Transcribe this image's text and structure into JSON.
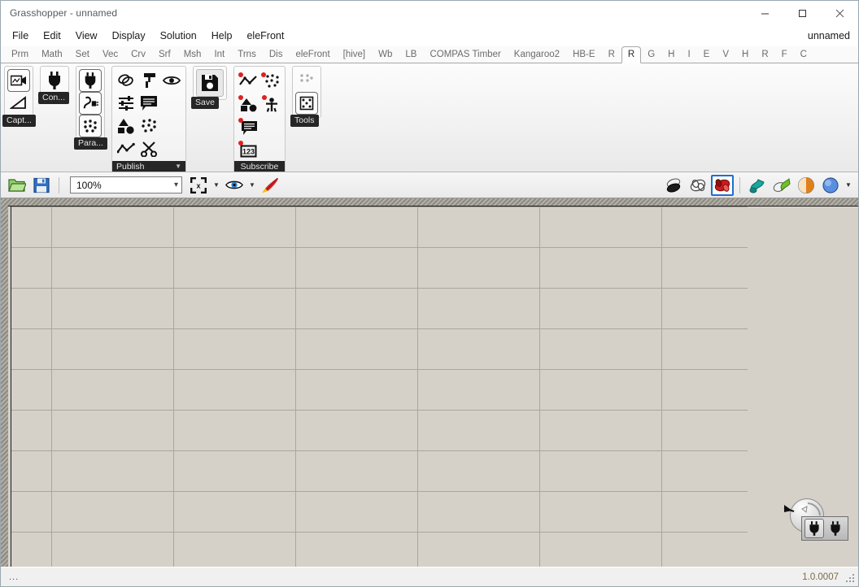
{
  "window": {
    "title": "Grasshopper - unnamed",
    "minimize_label": "minimize",
    "maximize_label": "maximize",
    "close_label": "close"
  },
  "menubar": {
    "items": [
      {
        "label": "File"
      },
      {
        "label": "Edit"
      },
      {
        "label": "View"
      },
      {
        "label": "Display"
      },
      {
        "label": "Solution"
      },
      {
        "label": "Help"
      },
      {
        "label": "eleFront"
      }
    ],
    "document_name": "unnamed"
  },
  "tabbar": {
    "active_index": 18,
    "tabs": [
      {
        "label": "Prm"
      },
      {
        "label": "Math"
      },
      {
        "label": "Set"
      },
      {
        "label": "Vec"
      },
      {
        "label": "Crv"
      },
      {
        "label": "Srf"
      },
      {
        "label": "Msh"
      },
      {
        "label": "Int"
      },
      {
        "label": "Trns"
      },
      {
        "label": "Dis"
      },
      {
        "label": "eleFront"
      },
      {
        "label": "[hive]"
      },
      {
        "label": "Wb"
      },
      {
        "label": "LB"
      },
      {
        "label": "COMPAS Timber"
      },
      {
        "label": "Kangaroo2"
      },
      {
        "label": "HB-E"
      },
      {
        "label": "R"
      },
      {
        "label": "R"
      },
      {
        "label": "G"
      },
      {
        "label": "H"
      },
      {
        "label": "I"
      },
      {
        "label": "E"
      },
      {
        "label": "V"
      },
      {
        "label": "H"
      },
      {
        "label": "R"
      },
      {
        "label": "F"
      },
      {
        "label": "C"
      }
    ]
  },
  "ribbon": {
    "groups": [
      {
        "name": "capture",
        "label": "Capt...",
        "icons": [
          {
            "name": "video-camera-icon"
          },
          {
            "name": "angle-triangle-icon"
          }
        ]
      },
      {
        "name": "connect",
        "label": "Con...",
        "icons": [
          {
            "name": "plug-icon"
          }
        ]
      },
      {
        "name": "parameters",
        "label": "Para...",
        "icons": [
          {
            "name": "plug-framed-icon"
          },
          {
            "name": "socket-cable-icon"
          },
          {
            "name": "dots-framed-icon"
          }
        ]
      },
      {
        "name": "publish",
        "label": "Publish",
        "caret": "▼",
        "icons": [
          {
            "name": "rings-link-icon"
          },
          {
            "name": "paint-roller-icon"
          },
          {
            "name": "eye-icon"
          },
          {
            "name": "sliders-icon"
          },
          {
            "name": "speech-bubble-icon"
          },
          {
            "name": "shapes-icon"
          },
          {
            "name": "dots-scatter-icon"
          },
          {
            "name": "polyline-chart-icon"
          },
          {
            "name": "scissors-icon"
          }
        ]
      },
      {
        "name": "save",
        "label": "Save",
        "icons": [
          {
            "name": "floppy-disk-icon"
          }
        ]
      },
      {
        "name": "subscribe",
        "label": "Subscribe",
        "icons": [
          {
            "name": "polyline-chart-sub-icon"
          },
          {
            "name": "dots-scatter-sub-icon"
          },
          {
            "name": "shapes-sub-icon"
          },
          {
            "name": "person-sub-icon"
          },
          {
            "name": "speech-bubble-sub-icon"
          },
          {
            "name": "number-123-sub-icon"
          }
        ]
      },
      {
        "name": "tools",
        "label": "Tools",
        "icons": [
          {
            "name": "dots-plain-icon"
          },
          {
            "name": "dots-boxed-icon"
          }
        ]
      }
    ]
  },
  "canvas_toolbar": {
    "open_icon": "open-folder-icon",
    "save_icon": "save-floppy-icon",
    "zoom_value": "100%",
    "zoom_chevron": "⌄",
    "zoom_extents_icon": "zoom-extents-icon",
    "preview_eye_icon": "preview-eye-icon",
    "paintbrush_icon": "paintbrush-icon",
    "dropdown_caret": "▼",
    "right_icons": [
      {
        "name": "shaded-preview-icon",
        "selected": false
      },
      {
        "name": "wireframe-preview-icon",
        "selected": false
      },
      {
        "name": "render-preview-icon",
        "selected": true
      },
      {
        "name": "teal-material-icon",
        "selected": false
      },
      {
        "name": "green-material-icon",
        "selected": false
      },
      {
        "name": "orange-sphere-icon",
        "selected": false
      },
      {
        "name": "blue-sphere-icon",
        "selected": false
      }
    ]
  },
  "canvas": {
    "widget": {
      "dial_name": "remote-dial-widget",
      "plug_buttons": [
        {
          "name": "plug-connected-button",
          "active": true
        },
        {
          "name": "plug-disconnected-button",
          "active": false
        }
      ]
    }
  },
  "statusbar": {
    "message": "...",
    "version": "1.0.0007"
  },
  "colors": {
    "canvas_bg": "#d5d1c8",
    "grid_line": "#a9a69c",
    "accent_selected": "#1f6fd0",
    "subscribe_dot": "#e02020",
    "label_bg": "#262626"
  }
}
